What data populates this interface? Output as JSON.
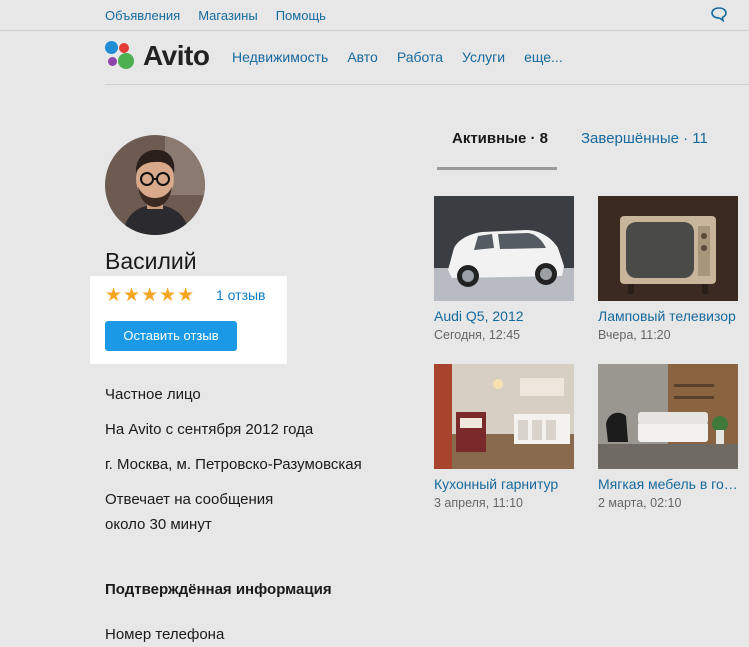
{
  "topbar": {
    "links": [
      "Объявления",
      "Магазины",
      "Помощь"
    ],
    "chat_icon": "chat-bubble-icon"
  },
  "header": {
    "logo_text": "Avito",
    "nav": [
      "Недвижимость",
      "Авто",
      "Работа",
      "Услуги",
      "еще..."
    ]
  },
  "profile": {
    "name": "Василий",
    "rating_stars": 5,
    "stars_text": "★★★★★",
    "reviews_link": "1 отзыв",
    "review_button": "Оставить отзыв",
    "seller_type": "Частное лицо",
    "member_since": "На Avito с сентября 2012 года",
    "location": "г. Москва, м. Петровско-Разумовская",
    "response_line1": "Отвечает на сообщения",
    "response_line2": "около 30 минут",
    "verified_title": "Подтверждённая информация",
    "verified_phone": "Номер телефона"
  },
  "tabs": {
    "active": "Активные · 8",
    "finished": "Завершённые · 11"
  },
  "listings": [
    {
      "title": "Audi Q5, 2012",
      "date": "Сегодня, 12:45",
      "image": "white-suv-photo"
    },
    {
      "title": "Ламповый телевизор",
      "date": "Вчера, 11:20",
      "image": "retro-tv-photo"
    },
    {
      "title": "Кухонный гарнитур",
      "date": "3 апреля, 11:10",
      "image": "kitchen-photo"
    },
    {
      "title": "Мягкая мебель в гостиную",
      "date": "2 марта, 02:10",
      "image": "living-room-photo"
    }
  ],
  "colors": {
    "link": "#166a9e",
    "button": "#1a9ae6",
    "star": "#f5a623",
    "dim_overlay": "#e7e7e7"
  }
}
